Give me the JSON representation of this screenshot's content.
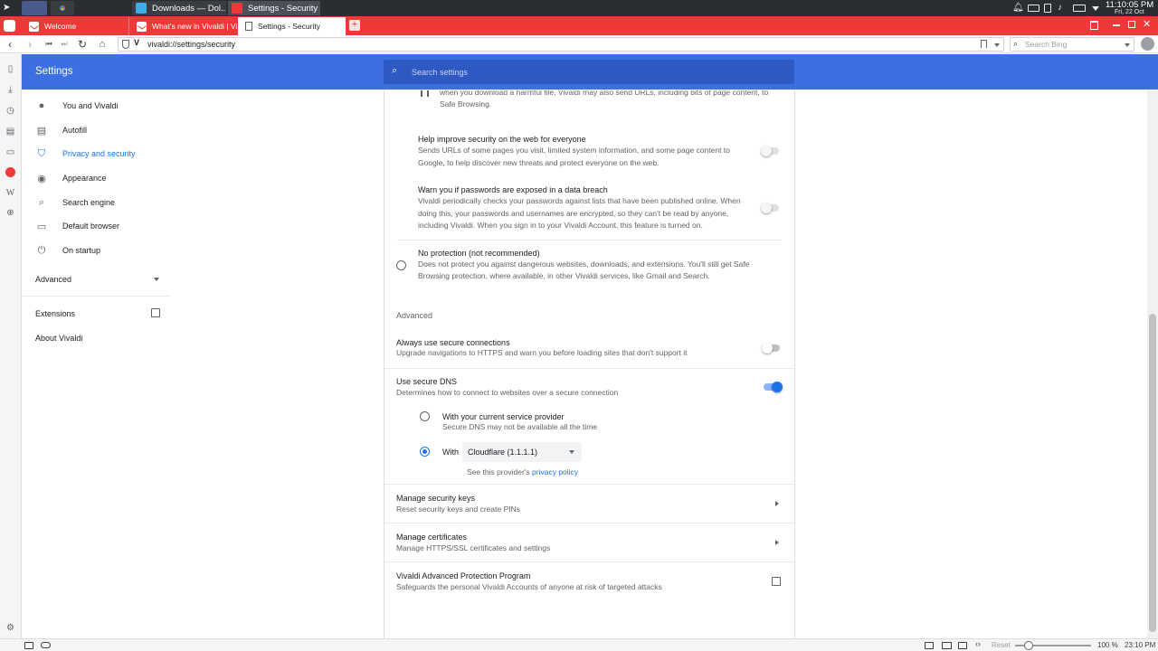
{
  "taskbar": {
    "windows": [
      {
        "label": "Downloads — Dol..."
      },
      {
        "label": "Settings - Security ..."
      }
    ],
    "clock": {
      "time": "11:10:05 PM",
      "date": "Fri, 22 Oct"
    }
  },
  "tabs": [
    {
      "label": "Welcome"
    },
    {
      "label": "What's new in Vivaldi | Viv..."
    },
    {
      "label": "Settings - Security"
    }
  ],
  "address": {
    "url": "vivaldi://settings/security",
    "search_placeholder": "Search Bing"
  },
  "header": {
    "title": "Settings",
    "search_placeholder": "Search settings"
  },
  "sidebar": {
    "items": [
      {
        "label": "You and Vivaldi",
        "icon": "person-icon"
      },
      {
        "label": "Autofill",
        "icon": "clipboard-icon"
      },
      {
        "label": "Privacy and security",
        "icon": "shield-icon"
      },
      {
        "label": "Appearance",
        "icon": "palette-icon"
      },
      {
        "label": "Search engine",
        "icon": "search-icon"
      },
      {
        "label": "Default browser",
        "icon": "browser-icon"
      },
      {
        "label": "On startup",
        "icon": "power-icon"
      }
    ],
    "advanced": "Advanced",
    "extensions": "Extensions",
    "about": "About Vivaldi"
  },
  "main": {
    "top_desc_line1": "when you download a harmful file, Vivaldi may also send URLs, including bits of page content, to",
    "top_desc_line2": "Safe Browsing.",
    "help_improve": {
      "title": "Help improve security on the web for everyone",
      "line1": "Sends URLs of some pages you visit, limited system information, and some page content to",
      "line2": "Google, to help discover new threats and protect everyone on the web."
    },
    "warn_breach": {
      "title": "Warn you if passwords are exposed in a data breach",
      "line1": "Vivaldi periodically checks your passwords against lists that have been published online. When",
      "line2": "doing this, your passwords and usernames are encrypted, so they can't be read by anyone,",
      "line3": "including Vivaldi. When you sign in to your Vivaldi Account, this feature is turned on."
    },
    "no_protection": {
      "title": "No protection (not recommended)",
      "line1": "Does not protect you against dangerous websites, downloads, and extensions. You'll still get Safe",
      "line2": "Browsing protection, where available, in other Vivaldi services, like Gmail and Search."
    },
    "advanced_heading": "Advanced",
    "https": {
      "title": "Always use secure connections",
      "desc": "Upgrade navigations to HTTPS and warn you before loading sites that don't support it"
    },
    "dns": {
      "title": "Use secure DNS",
      "desc": "Determines how to connect to websites over a secure connection",
      "option1_title": "With your current service provider",
      "option1_desc": "Secure DNS may not be available all the time",
      "option2_label": "With",
      "provider": "Cloudflare (1.1.1.1)",
      "policy_prefix": "See this provider's",
      "policy_link": "privacy policy"
    },
    "security_keys": {
      "title": "Manage security keys",
      "desc": "Reset security keys and create PINs"
    },
    "certificates": {
      "title": "Manage certificates",
      "desc": "Manage HTTPS/SSL certificates and settings"
    },
    "app": {
      "title": "Vivaldi Advanced Protection Program",
      "desc": "Safeguards the personal Vivaldi Accounts of anyone at risk of targeted attacks"
    }
  },
  "status": {
    "reset": "Reset",
    "zoom": "100 %",
    "time": "23:10 PM"
  },
  "colors": {
    "accent": "#3c6fe0",
    "tabbar": "#ef3939",
    "link": "#1a73e8"
  }
}
